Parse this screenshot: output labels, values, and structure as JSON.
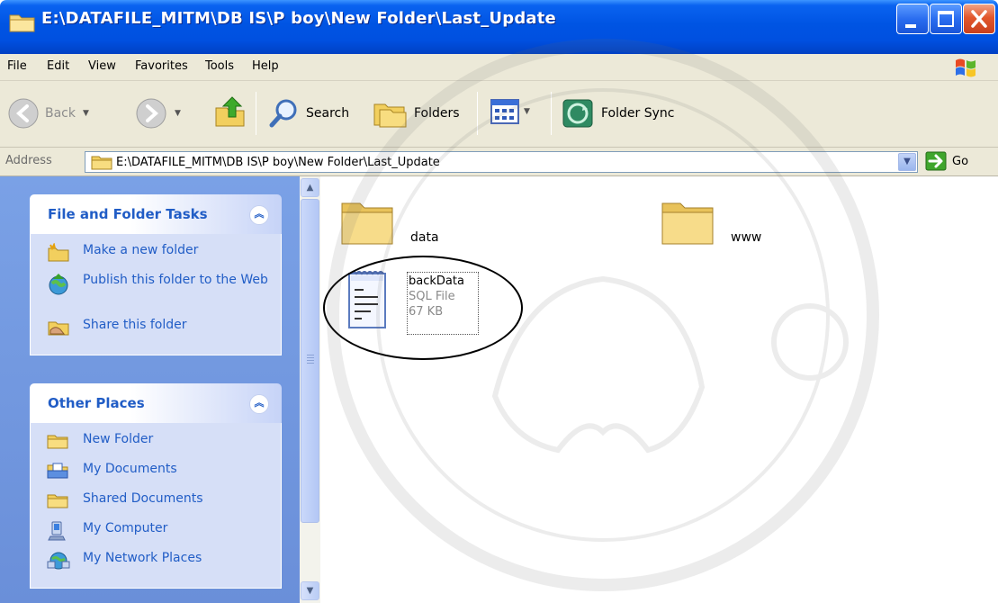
{
  "window": {
    "title": "E:\\DATAFILE_MITM\\DB IS\\P boy\\New Folder\\Last_Update"
  },
  "menu": [
    "File",
    "Edit",
    "View",
    "Favorites",
    "Tools",
    "Help"
  ],
  "toolbar": {
    "back_label": "Back",
    "search_label": "Search",
    "folders_label": "Folders",
    "folder_sync_label": "Folder Sync"
  },
  "address": {
    "label": "Address",
    "value": "E:\\DATAFILE_MITM\\DB IS\\P boy\\New Folder\\Last_Update",
    "go_label": "Go"
  },
  "tasks_panel": {
    "title": "File and Folder Tasks",
    "items": [
      "Make a new folder",
      "Publish this folder to the Web",
      "Share this folder"
    ]
  },
  "places_panel": {
    "title": "Other Places",
    "items": [
      "New Folder",
      "My Documents",
      "Shared Documents",
      "My Computer",
      "My Network Places"
    ]
  },
  "files": {
    "folders": [
      "data",
      "www"
    ],
    "sql_file": {
      "name": "backData",
      "type": "SQL File",
      "size": "67 KB"
    }
  },
  "colors": {
    "titlebar": "#0054e3",
    "taskpane": "#7aa1e6",
    "panel_title": "#215dc6",
    "chrome": "#ece9d8"
  }
}
